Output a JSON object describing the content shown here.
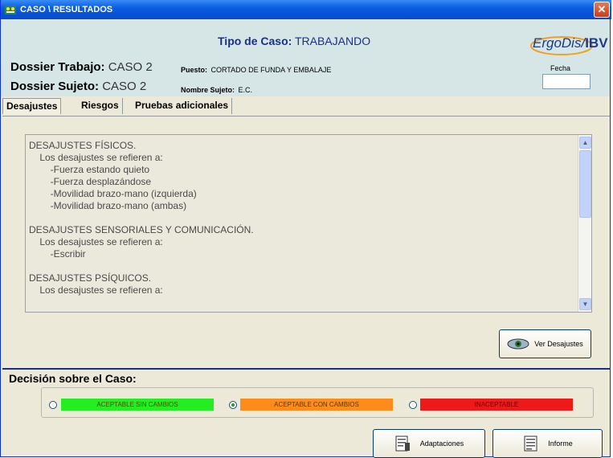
{
  "window": {
    "title": "CASO \\ RESULTADOS",
    "close_glyph": "✕"
  },
  "header": {
    "tipo_label": "Tipo de Caso:",
    "tipo_value": "TRABAJANDO",
    "dossier_trabajo_label": "Dossier Trabajo:",
    "dossier_trabajo_value": "CASO 2",
    "dossier_sujeto_label": "Dossier Sujeto:",
    "dossier_sujeto_value": "CASO 2",
    "puesto_label": "Puesto:",
    "puesto_value": "CORTADO DE FUNDA Y EMBALAJE",
    "nombre_label": "Nombre Sujeto:",
    "nombre_value": "E.C.",
    "fecha_label": "Fecha",
    "fecha_value": "",
    "logo_text": "ErgoDis/",
    "logo_ibv": "IBV"
  },
  "tabs": [
    {
      "label": "Desajustes",
      "active": true
    },
    {
      "label": "Riesgos",
      "active": false
    },
    {
      "label": "Pruebas adicionales",
      "active": false
    }
  ],
  "textarea": {
    "lines": [
      "DESAJUSTES FÍSICOS.",
      "    Los desajustes se refieren a:",
      "        -Fuerza estando quieto",
      "        -Fuerza desplazándose",
      "        -Movilidad brazo-mano (izquierda)",
      "        -Movilidad brazo-mano (ambas)",
      "",
      "DESAJUSTES SENSORIALES Y COMUNICACIÓN.",
      "    Los desajustes se refieren a:",
      "        -Escribir",
      "",
      "DESAJUSTES PSÍQUICOS.",
      "    Los desajustes se refieren a:"
    ],
    "scroll_up": "▲",
    "scroll_down": "▼"
  },
  "buttons": {
    "ver_desajustes": "Ver Desajustes",
    "adaptaciones": "Adaptaciones",
    "informe": "Informe"
  },
  "decision": {
    "title": "Decisión sobre el Caso:",
    "options": [
      {
        "label": "ACEPTABLE SIN CAMBIOS",
        "color": "#22ee22",
        "selected": false
      },
      {
        "label": "ACEPTABLE CON CAMBIOS",
        "color": "#ff8c1a",
        "selected": true
      },
      {
        "label": "INACEPTABLE",
        "color": "#ee1a1a",
        "selected": false
      }
    ]
  },
  "icons": {
    "app": "app-icon",
    "eye": "eye-icon",
    "adaptaciones": "document-edit-icon",
    "informe": "report-icon"
  }
}
